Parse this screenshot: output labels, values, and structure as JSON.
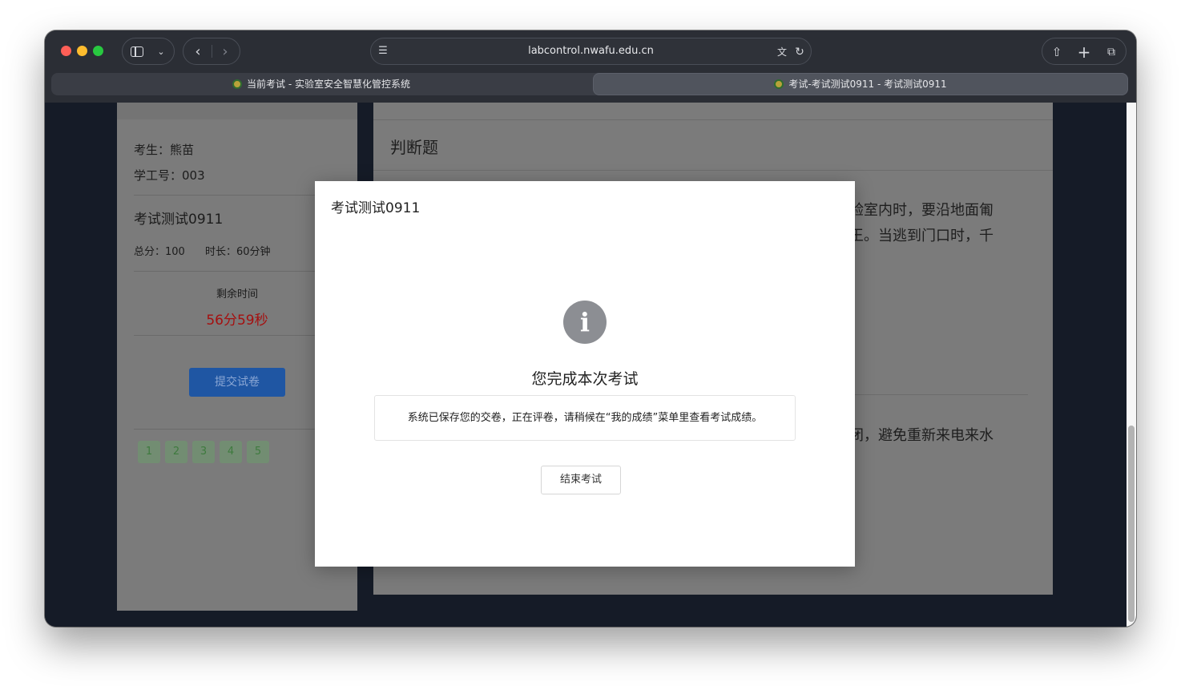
{
  "browser": {
    "url": "labcontrol.nwafu.edu.cn",
    "tabs": [
      {
        "title": "当前考试 - 实验室安全智慧化管控系统",
        "active": false
      },
      {
        "title": "考试-考试测试0911 - 考试测试0911",
        "active": true
      }
    ],
    "icons": [
      "sidebar-toggle-icon",
      "chevron-down-icon",
      "back-arrow-icon",
      "forward-arrow-icon",
      "site-settings-icon",
      "translate-icon",
      "reload-icon",
      "share-icon",
      "new-tab-icon",
      "tab-overview-icon"
    ]
  },
  "exam_info": {
    "candidate": "考生：熊苗",
    "student_id": "学工号：003",
    "exam_name": "考试测试0911",
    "total_score": "总分：100",
    "duration": "时长：60分钟",
    "remaining_label": "剩余时间",
    "remaining_time": "56分59秒",
    "submit_label": "提交试卷",
    "question_numbers": [
      "1",
      "2",
      "3",
      "4",
      "5"
    ]
  },
  "question_panel": {
    "section_title": "判断题",
    "q1_line1": "验室内时，要沿地面匍",
    "q1_line2": "王。当逃到门口时，千",
    "q2_line1": "闭，避免重新来电来水"
  },
  "modal": {
    "title": "考试测试0911",
    "heading": "您完成本次考试",
    "message": "系统已保存您的交卷，正在评卷，请稍候在“我的成绩”菜单里查看考试成绩。",
    "end_button": "结束考试"
  },
  "colors": {
    "remaining_time": "#a50f0f",
    "submit_button": "#1f56a3",
    "question_number_bg": "#728d72"
  }
}
